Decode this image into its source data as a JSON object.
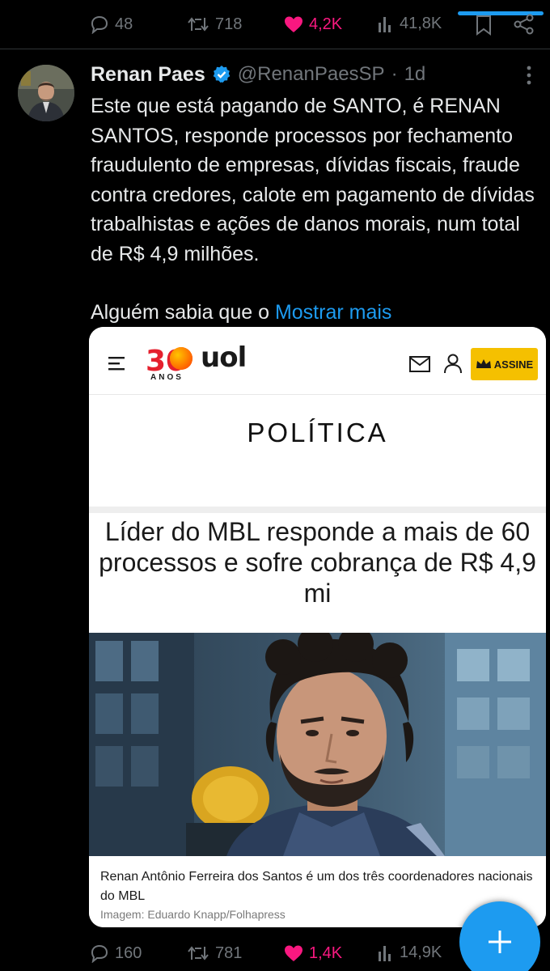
{
  "prev_actions": {
    "replies": "48",
    "reposts": "718",
    "likes": "4,2K",
    "views": "41,8K"
  },
  "tweet": {
    "display_name": "Renan Paes",
    "handle": "@RenanPaesSP",
    "separator": "·",
    "time": "1d",
    "text_para1": "Este que está pagando de SANTO, é RENAN SANTOS, responde processos por fechamento fraudulento de empresas, dívidas fiscais, fraude contra credores, calote em pagamento de dívidas trabalhistas e ações de danos morais, num total de R$ 4,9 milhões.",
    "text_para2": "Alguém sabia que o",
    "show_more": "Mostrar mais"
  },
  "media": {
    "logo_number": "30",
    "logo_brand": "uol",
    "logo_sub": "ANOS",
    "subscribe_label": "ASSINE",
    "section": "POLÍTICA",
    "headline": "Líder do MBL responde a mais de 60 processos e sofre cobrança de R$ 4,9 mi",
    "caption": "Renan Antônio Ferreira dos Santos é um dos três coordenadores nacionais do MBL",
    "credit": "Imagem: Eduardo Knapp/Folhapress"
  },
  "actions": {
    "replies": "160",
    "reposts": "781",
    "likes": "1,4K",
    "views": "14,9K"
  },
  "colors": {
    "accent": "#1d9bf0",
    "like": "#f91880",
    "muted": "#71767b",
    "subscribe": "#f5c000",
    "logo_orange": "#ff6a00"
  }
}
